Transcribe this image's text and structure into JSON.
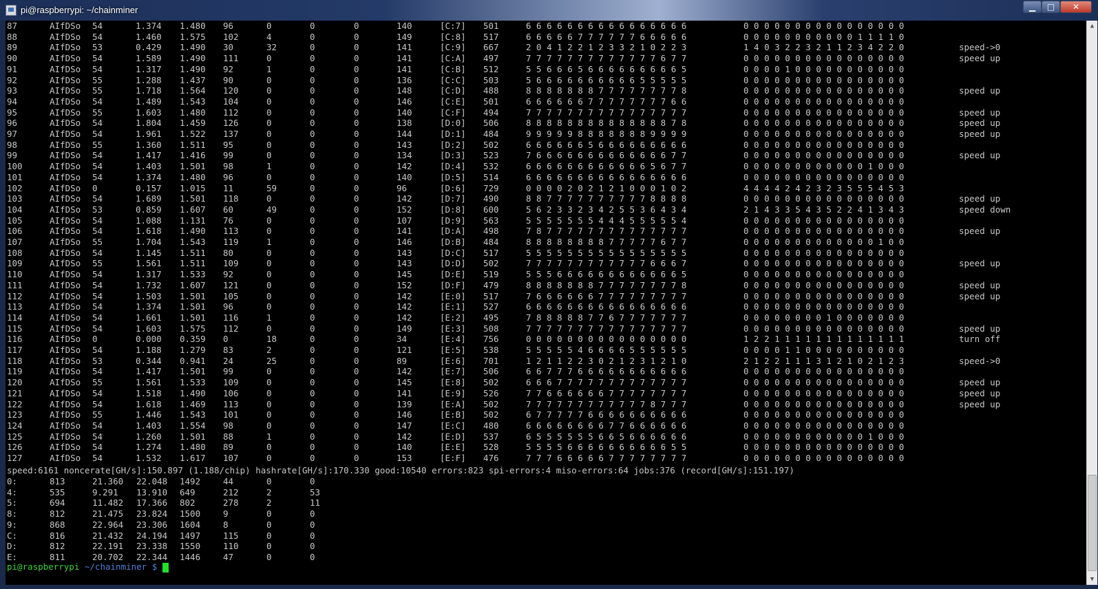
{
  "window": {
    "title": "pi@raspberrypi: ~/chainminer",
    "minimize": "▁",
    "maximize": "□",
    "close": "✕",
    "icon": "putty-icon"
  },
  "rows": [
    [
      "87",
      "AIfDSo",
      "54",
      "1.374",
      "1.480",
      "96",
      "0",
      "0",
      "0",
      "140",
      "[C:7]",
      "501",
      "6 6 6 6 6 6 6 6 6 6 6 6 6 6 6 6",
      "0 0 0 0 0 0 0 0 0 0 0 0 0 0 0 0",
      ""
    ],
    [
      "88",
      "AIfDSo",
      "54",
      "1.460",
      "1.575",
      "102",
      "4",
      "0",
      "0",
      "149",
      "[C:8]",
      "517",
      "6 6 6 6 6 7 7 7 7 7 7 6 6 6 6 6",
      "0 0 0 0 0 0 0 0 0 0 0 1 1 1 1 0",
      ""
    ],
    [
      "89",
      "AIfDSo",
      "53",
      "0.429",
      "1.490",
      "30",
      "32",
      "0",
      "0",
      "141",
      "[C:9]",
      "667",
      "2 0 4 1 2 2 1 2 3 3 2 1 0 2 2 3",
      "1 4 0 3 2 2 3 2 1 1 2 3 4 2 2 0",
      "speed->0"
    ],
    [
      "90",
      "AIfDSo",
      "54",
      "1.589",
      "1.490",
      "111",
      "0",
      "0",
      "0",
      "141",
      "[C:A]",
      "497",
      "7 7 7 7 7 7 7 7 7 7 7 7 7 6 7 7",
      "0 0 0 0 0 0 0 0 0 0 0 0 0 0 0 0",
      "speed up"
    ],
    [
      "91",
      "AIfDSo",
      "54",
      "1.317",
      "1.490",
      "92",
      "1",
      "0",
      "0",
      "141",
      "[C:B]",
      "512",
      "5 5 6 6 6 5 6 6 6 6 6 6 6 6 6 5",
      "0 0 0 0 1 0 0 0 0 0 0 0 0 0 0 0",
      ""
    ],
    [
      "92",
      "AIfDSo",
      "55",
      "1.288",
      "1.437",
      "90",
      "0",
      "0",
      "0",
      "136",
      "[C:C]",
      "503",
      "5 6 6 6 6 6 6 6 6 6 6 5 5 5 5 5",
      "0 0 0 0 0 0 0 0 0 0 0 0 0 0 0 0",
      ""
    ],
    [
      "93",
      "AIfDSo",
      "55",
      "1.718",
      "1.564",
      "120",
      "0",
      "0",
      "0",
      "148",
      "[C:D]",
      "488",
      "8 8 8 8 8 8 8 7 7 7 7 7 7 7 7 8",
      "0 0 0 0 0 0 0 0 0 0 0 0 0 0 0 0",
      "speed up"
    ],
    [
      "94",
      "AIfDSo",
      "54",
      "1.489",
      "1.543",
      "104",
      "0",
      "0",
      "0",
      "146",
      "[C:E]",
      "501",
      "6 6 6 6 6 6 7 7 7 7 7 7 7 7 6 6",
      "0 0 0 0 0 0 0 0 0 0 0 0 0 0 0 0",
      ""
    ],
    [
      "95",
      "AIfDSo",
      "55",
      "1.603",
      "1.480",
      "112",
      "0",
      "0",
      "0",
      "140",
      "[C:F]",
      "494",
      "7 7 7 7 7 7 7 7 7 7 7 7 7 7 7 7",
      "0 0 0 0 0 0 0 0 0 0 0 0 0 0 0 0",
      "speed up"
    ],
    [
      "96",
      "AIfDSo",
      "54",
      "1.804",
      "1.459",
      "126",
      "0",
      "0",
      "0",
      "138",
      "[D:0]",
      "506",
      "8 8 8 8 8 8 8 8 8 8 8 8 8 8 7 8",
      "0 0 0 0 0 0 0 0 0 0 0 0 0 0 0 0",
      "speed up"
    ],
    [
      "97",
      "AIfDSo",
      "54",
      "1.961",
      "1.522",
      "137",
      "0",
      "0",
      "0",
      "144",
      "[D:1]",
      "484",
      "9 9 9 9 9 8 8 8 8 8 8 8 9 9 9 9",
      "0 0 0 0 0 0 0 0 0 0 0 0 0 0 0 0",
      "speed up"
    ],
    [
      "98",
      "AIfDSo",
      "55",
      "1.360",
      "1.511",
      "95",
      "0",
      "0",
      "0",
      "143",
      "[D:2]",
      "502",
      "6 6 6 6 6 6 5 6 6 6 6 6 6 6 6 6",
      "0 0 0 0 0 0 0 0 0 0 0 0 0 0 0 0",
      ""
    ],
    [
      "99",
      "AIfDSo",
      "54",
      "1.417",
      "1.416",
      "99",
      "0",
      "0",
      "0",
      "134",
      "[D:3]",
      "523",
      "7 6 6 6 6 6 6 6 6 6 6 6 6 6 7 7",
      "0 0 0 0 0 0 0 0 0 0 0 0 0 0 0 0",
      "speed up"
    ],
    [
      "100",
      "AIfDSo",
      "54",
      "1.403",
      "1.501",
      "98",
      "1",
      "0",
      "0",
      "142",
      "[D:4]",
      "532",
      "6 6 6 6 6 6 6 6 6 6 6 6 5 6 7 7",
      "0 0 0 0 0 0 0 0 0 0 0 0 1 0 0 0",
      ""
    ],
    [
      "101",
      "AIfDSo",
      "54",
      "1.374",
      "1.480",
      "96",
      "0",
      "0",
      "0",
      "140",
      "[D:5]",
      "514",
      "6 6 6 6 6 6 6 6 6 6 6 6 6 6 6 6",
      "0 0 0 0 0 0 0 0 0 0 0 0 0 0 0 0",
      ""
    ],
    [
      "102",
      "AIfDSo",
      "0",
      "0.157",
      "1.015",
      "11",
      "59",
      "0",
      "0",
      "96",
      "[D:6]",
      "729",
      "0 0 0 0 2 0 2 1 2 1 0 0 0 1 0 2",
      "4 4 4 4 2 4 2 3 2 3 5 5 5 4 5 3",
      ""
    ],
    [
      "103",
      "AIfDSo",
      "54",
      "1.689",
      "1.501",
      "118",
      "0",
      "0",
      "0",
      "142",
      "[D:7]",
      "490",
      "8 8 7 7 7 7 7 7 7 7 7 7 8 8 8 8",
      "0 0 0 0 0 0 0 0 0 0 0 0 0 0 0 0",
      "speed up"
    ],
    [
      "104",
      "AIfDSo",
      "53",
      "0.859",
      "1.607",
      "60",
      "49",
      "0",
      "0",
      "152",
      "[D:8]",
      "600",
      "5 6 2 3 3 2 3 4 2 5 5 3 6 4 3 4",
      "2 1 4 3 3 5 4 3 5 2 2 4 1 3 4 3",
      "speed down"
    ],
    [
      "105",
      "AIfDSo",
      "54",
      "1.088",
      "1.131",
      "76",
      "0",
      "0",
      "0",
      "107",
      "[D:9]",
      "563",
      "5 5 5 5 5 5 5 4 4 4 5 5 5 5 5 4",
      "0 0 0 0 0 0 0 0 0 0 0 0 0 0 0 0",
      ""
    ],
    [
      "106",
      "AIfDSo",
      "54",
      "1.618",
      "1.490",
      "113",
      "0",
      "0",
      "0",
      "141",
      "[D:A]",
      "498",
      "7 8 7 7 7 7 7 7 7 7 7 7 7 7 7 7",
      "0 0 0 0 0 0 0 0 0 0 0 0 0 0 0 0",
      "speed up"
    ],
    [
      "107",
      "AIfDSo",
      "55",
      "1.704",
      "1.543",
      "119",
      "1",
      "0",
      "0",
      "146",
      "[D:B]",
      "484",
      "8 8 8 8 8 8 8 8 7 7 7 7 7 6 7 7",
      "0 0 0 0 0 0 0 0 0 0 0 0 0 1 0 0",
      ""
    ],
    [
      "108",
      "AIfDSo",
      "54",
      "1.145",
      "1.511",
      "80",
      "0",
      "0",
      "0",
      "143",
      "[D:C]",
      "517",
      "5 5 5 5 5 5 5 5 5 5 5 5 5 5 5 5",
      "0 0 0 0 0 0 0 0 0 0 0 0 0 0 0 0",
      ""
    ],
    [
      "109",
      "AIfDSo",
      "55",
      "1.561",
      "1.511",
      "109",
      "0",
      "0",
      "0",
      "143",
      "[D:D]",
      "502",
      "7 7 7 7 7 7 7 7 7 7 7 7 6 6 6 7",
      "0 0 0 0 0 0 0 0 0 0 0 0 0 0 0 0",
      "speed up"
    ],
    [
      "110",
      "AIfDSo",
      "54",
      "1.317",
      "1.533",
      "92",
      "0",
      "0",
      "0",
      "145",
      "[D:E]",
      "519",
      "5 5 5 6 6 6 6 6 6 6 6 6 6 6 6 5",
      "0 0 0 0 0 0 0 0 0 0 0 0 0 0 0 0",
      ""
    ],
    [
      "111",
      "AIfDSo",
      "54",
      "1.732",
      "1.607",
      "121",
      "0",
      "0",
      "0",
      "152",
      "[D:F]",
      "479",
      "8 8 8 8 8 8 8 7 7 7 7 7 7 7 7 8",
      "0 0 0 0 0 0 0 0 0 0 0 0 0 0 0 0",
      "speed up"
    ],
    [
      "112",
      "AIfDSo",
      "54",
      "1.503",
      "1.501",
      "105",
      "0",
      "0",
      "0",
      "142",
      "[E:0]",
      "517",
      "7 6 6 6 6 6 6 7 7 7 7 7 7 7 7 7",
      "0 0 0 0 0 0 0 0 0 0 0 0 0 0 0 0",
      "speed up"
    ],
    [
      "113",
      "AIfDSo",
      "54",
      "1.374",
      "1.501",
      "96",
      "0",
      "0",
      "0",
      "142",
      "[E:1]",
      "527",
      "6 6 6 6 6 6 6 6 6 6 6 6 6 6 6 6",
      "0 0 0 0 0 0 0 0 0 0 0 0 0 0 0 0",
      ""
    ],
    [
      "114",
      "AIfDSo",
      "54",
      "1.661",
      "1.501",
      "116",
      "1",
      "0",
      "0",
      "142",
      "[E:2]",
      "495",
      "7 8 8 8 8 8 7 7 6 7 7 7 7 7 7 7",
      "0 0 0 0 0 0 0 0 1 0 0 0 0 0 0 0",
      ""
    ],
    [
      "115",
      "AIfDSo",
      "54",
      "1.603",
      "1.575",
      "112",
      "0",
      "0",
      "0",
      "149",
      "[E:3]",
      "508",
      "7 7 7 7 7 7 7 7 7 7 7 7 7 7 7 7",
      "0 0 0 0 0 0 0 0 0 0 0 0 0 0 0 0",
      "speed up"
    ],
    [
      "116",
      "AIfDSo",
      "0",
      "0.000",
      "0.359",
      "0",
      "18",
      "0",
      "0",
      "34",
      "[E:4]",
      "756",
      "0 0 0 0 0 0 0 0 0 0 0 0 0 0 0 0",
      "1 2 2 1 1 1 1 1 1 1 1 1 1 1 1 1",
      "turn off"
    ],
    [
      "117",
      "AIfDSo",
      "54",
      "1.188",
      "1.279",
      "83",
      "2",
      "0",
      "0",
      "121",
      "[E:5]",
      "538",
      "5 5 5 5 5 4 6 6 6 6 5 5 5 5 5 5",
      "0 0 0 0 1 1 0 0 0 0 0 0 0 0 0 0",
      ""
    ],
    [
      "118",
      "AIfDSo",
      "53",
      "0.344",
      "0.941",
      "24",
      "25",
      "0",
      "0",
      "89",
      "[E:6]",
      "701",
      "1 2 1 1 2 2 3 0 2 1 2 3 1 2 1 0",
      "2 1 2 2 1 1 1 3 1 2 1 0 2 1 2 3",
      "speed->0"
    ],
    [
      "119",
      "AIfDSo",
      "54",
      "1.417",
      "1.501",
      "99",
      "0",
      "0",
      "0",
      "142",
      "[E:7]",
      "506",
      "6 6 7 7 7 6 6 6 6 6 6 6 6 6 6 6",
      "0 0 0 0 0 0 0 0 0 0 0 0 0 0 0 0",
      ""
    ],
    [
      "120",
      "AIfDSo",
      "55",
      "1.561",
      "1.533",
      "109",
      "0",
      "0",
      "0",
      "145",
      "[E:8]",
      "502",
      "6 6 6 7 7 7 7 7 7 7 7 7 7 7 7 7",
      "0 0 0 0 0 0 0 0 0 0 0 0 0 0 0 0",
      "speed up"
    ],
    [
      "121",
      "AIfDSo",
      "54",
      "1.518",
      "1.490",
      "106",
      "0",
      "0",
      "0",
      "141",
      "[E:9]",
      "526",
      "7 7 6 6 6 6 6 6 7 7 7 7 7 7 7 7",
      "0 0 0 0 0 0 0 0 0 0 0 0 0 0 0 0",
      "speed up"
    ],
    [
      "122",
      "AIfDSo",
      "54",
      "1.618",
      "1.469",
      "113",
      "0",
      "0",
      "0",
      "139",
      "[E:A]",
      "502",
      "7 7 7 7 7 7 7 7 7 7 7 7 8 7 7 7",
      "0 0 0 0 0 0 0 0 0 0 0 0 0 0 0 0",
      "speed up"
    ],
    [
      "123",
      "AIfDSo",
      "55",
      "1.446",
      "1.543",
      "101",
      "0",
      "0",
      "0",
      "146",
      "[E:B]",
      "502",
      "6 7 7 7 7 7 6 6 6 6 6 6 6 6 6 6",
      "0 0 0 0 0 0 0 0 0 0 0 0 0 0 0 0",
      ""
    ],
    [
      "124",
      "AIfDSo",
      "54",
      "1.403",
      "1.554",
      "98",
      "0",
      "0",
      "0",
      "147",
      "[E:C]",
      "480",
      "6 6 6 6 6 6 6 6 7 7 6 6 6 6 6 6",
      "0 0 0 0 0 0 0 0 0 0 0 0 0 0 0 0",
      ""
    ],
    [
      "125",
      "AIfDSo",
      "54",
      "1.260",
      "1.501",
      "88",
      "1",
      "0",
      "0",
      "142",
      "[E:D]",
      "537",
      "6 5 5 5 5 5 5 6 6 5 6 6 6 6 6 6",
      "0 0 0 0 0 0 0 0 0 0 0 0 1 0 0 0",
      ""
    ],
    [
      "126",
      "AIfDSo",
      "54",
      "1.274",
      "1.480",
      "89",
      "0",
      "0",
      "0",
      "140",
      "[E:E]",
      "528",
      "5 5 5 5 6 6 6 6 6 6 6 6 6 6 5 5",
      "0 0 0 0 0 0 0 0 0 0 0 0 0 0 0 0",
      ""
    ],
    [
      "127",
      "AIfDSo",
      "54",
      "1.532",
      "1.617",
      "107",
      "0",
      "0",
      "0",
      "153",
      "[E:F]",
      "476",
      "7 7 7 6 6 6 6 6 7 7 7 7 7 7 7 7",
      "0 0 0 0 0 0 0 0 0 0 0 0 0 0 0 0",
      ""
    ]
  ],
  "summary": "speed:6161 noncerate[GH/s]:150.897 (1.188/chip) hashrate[GH/s]:170.330 good:10540 errors:823 spi-errors:4 miso-errors:64 jobs:376 (record[GH/s]:151.197)",
  "boards": [
    [
      "0:",
      "813",
      "21.360",
      "22.048",
      "1492",
      "44",
      "0",
      "0"
    ],
    [
      "4:",
      "535",
      "9.291",
      "13.910",
      "649",
      "212",
      "2",
      "53"
    ],
    [
      "5:",
      "694",
      "11.482",
      "17.366",
      "802",
      "278",
      "2",
      "11"
    ],
    [
      "8:",
      "812",
      "21.475",
      "23.824",
      "1500",
      "9",
      "0",
      "0"
    ],
    [
      "9:",
      "868",
      "22.964",
      "23.306",
      "1604",
      "8",
      "0",
      "0"
    ],
    [
      "C:",
      "816",
      "21.432",
      "24.194",
      "1497",
      "115",
      "0",
      "0"
    ],
    [
      "D:",
      "812",
      "22.191",
      "23.338",
      "1550",
      "110",
      "0",
      "0"
    ],
    [
      "E:",
      "811",
      "20.702",
      "22.344",
      "1446",
      "47",
      "0",
      "0"
    ]
  ],
  "prompt": {
    "user": "pi@raspberrypi",
    "path": " ~/chainminer $ "
  },
  "scrollbar": {
    "up": "▲",
    "down": "▼"
  }
}
